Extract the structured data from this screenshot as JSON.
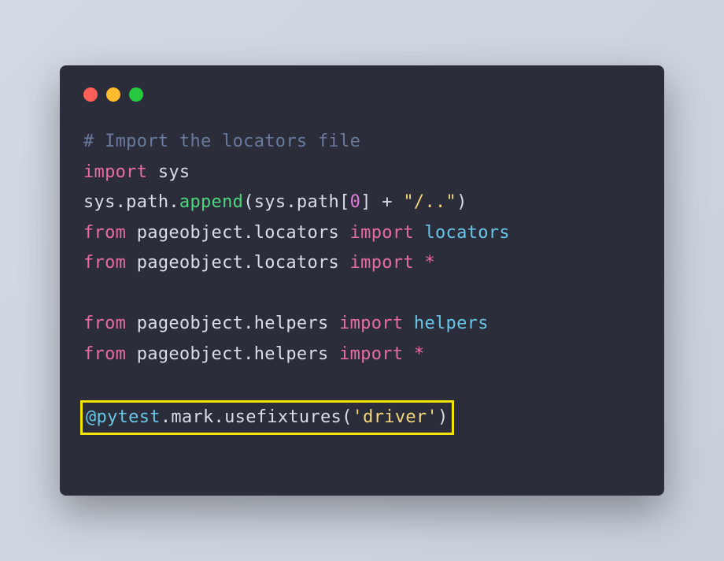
{
  "code": {
    "line1": {
      "comment": "# Import the locators file"
    },
    "line2": {
      "keyword": "import",
      "sp": " ",
      "module": "sys"
    },
    "line3": {
      "t1": "sys.path.",
      "fn": "append",
      "t2": "(sys.path[",
      "num": "0",
      "t3": "] ",
      "op": "+",
      "t4": " ",
      "str": "\"/..\"",
      "t5": ")"
    },
    "line4": {
      "kw1": "from",
      "sp1": " ",
      "mod": "pageobject.locators",
      "sp2": " ",
      "kw2": "import",
      "sp3": " ",
      "name": "locators"
    },
    "line5": {
      "kw1": "from",
      "sp1": " ",
      "mod": "pageobject.locators",
      "sp2": " ",
      "kw2": "import",
      "sp3": " ",
      "op": "*"
    },
    "line6": {
      "kw1": "from",
      "sp1": " ",
      "mod": "pageobject.helpers",
      "sp2": " ",
      "kw2": "import",
      "sp3": " ",
      "name": "helpers"
    },
    "line7": {
      "kw1": "from",
      "sp1": " ",
      "mod": "pageobject.helpers",
      "sp2": " ",
      "kw2": "import",
      "sp3": " ",
      "op": "*"
    },
    "line8": {
      "dec": "@pytest",
      "t1": ".mark.usefixtures(",
      "str": "'driver'",
      "t2": ")"
    }
  }
}
